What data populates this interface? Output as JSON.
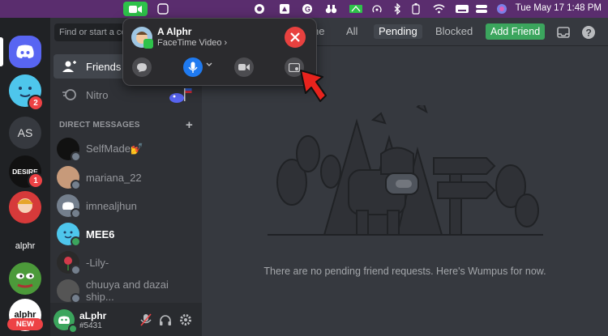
{
  "menubar": {
    "clock": "Tue May 17  1:48 PM"
  },
  "facetime": {
    "caller_name": "A Alphr",
    "subtitle": "FaceTime Video ›"
  },
  "sidebar": {
    "search_placeholder": "Find or start a co",
    "friends_label": "Friends",
    "nitro_label": "Nitro",
    "dm_header": "DIRECT MESSAGES",
    "dm_add": "+",
    "dms": [
      {
        "name": "SelfMade💅"
      },
      {
        "name": "mariana_22"
      },
      {
        "name": "imnealjhun"
      },
      {
        "name": "MEE6"
      },
      {
        "name": "-Lily-"
      },
      {
        "name": "chuuya and dazai ship..."
      }
    ]
  },
  "servers": {
    "as_label": "AS",
    "desire_label": "DESIRE",
    "alphr_label": "alphr",
    "alphr2_label": "alphr",
    "new_badge": "NEW",
    "badge_2": "2",
    "badge_1": "1"
  },
  "user": {
    "name": "aLphr",
    "tag": "#5431"
  },
  "topbar": {
    "tab_online": "ne",
    "tab_all": "All",
    "tab_pending": "Pending",
    "tab_blocked": "Blocked",
    "add_friend": "Add Friend"
  },
  "main": {
    "empty_message": "There are no pending friend requests. Here's Wumpus for now."
  },
  "colors": {
    "menubar": "#5a2d6e",
    "discord_blurple": "#5865f2",
    "online_green": "#3ba55d",
    "end_call_red": "#e8413f",
    "mic_blue": "#1f7af0"
  }
}
